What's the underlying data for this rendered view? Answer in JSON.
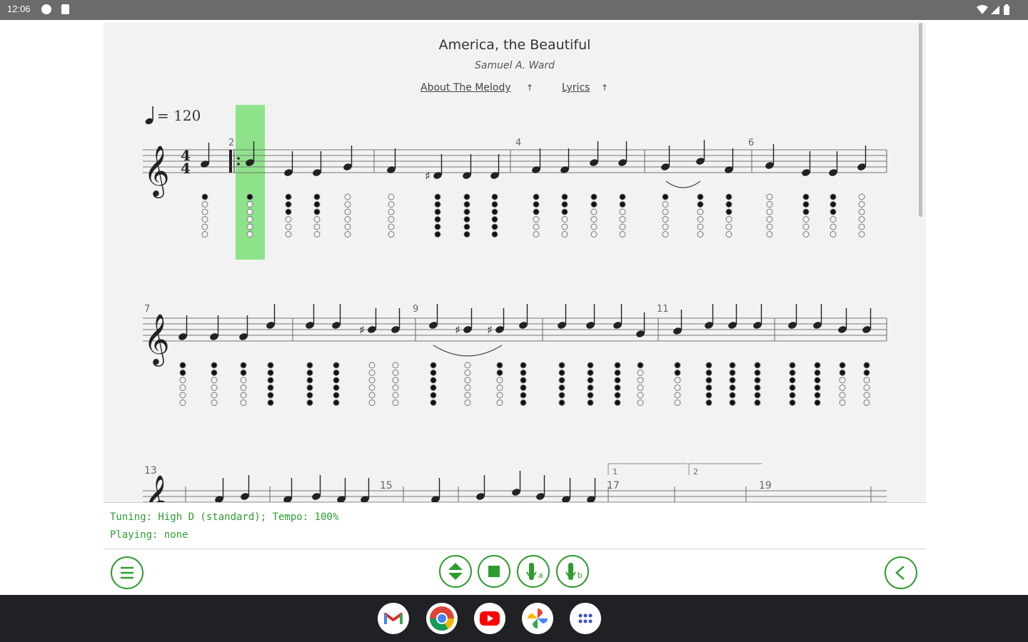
{
  "status_bar": {
    "time": "12:06"
  },
  "sheet": {
    "title": "America, the Beautiful",
    "author": "Samuel A. Ward",
    "links": [
      {
        "label": "About The Melody",
        "arrow": "↑"
      },
      {
        "label": "Lyrics",
        "arrow": "↑"
      }
    ],
    "tempo": "= 120",
    "time_signature": {
      "top": "4",
      "bottom": "4"
    },
    "measure_numbers": [
      "2",
      "4",
      "6",
      "7",
      "9",
      "11",
      "13",
      "15",
      "17",
      "19"
    ],
    "volta_labels": [
      "1",
      "2"
    ]
  },
  "info": {
    "tuning_line": "Tuning:  High D (standard); Tempo:   100%",
    "playing_line": "Playing: none"
  },
  "toolbar": {
    "buttons": [
      "menu-icon",
      "up-down-icon",
      "stop-icon",
      "whistle-a-icon",
      "whistle-b-icon",
      "back-icon"
    ],
    "whistle_a_label": "a",
    "whistle_b_label": "b"
  },
  "dock": {
    "apps": [
      "gmail-icon",
      "chrome-icon",
      "youtube-icon",
      "photos-icon",
      "app-grid-icon"
    ]
  },
  "colors": {
    "accent": "#2e9c2e",
    "highlight": "#8ee38a",
    "sheet_bg": "#f2f2f2",
    "nav_bg": "#202124",
    "status_bg": "#6b6b6b"
  }
}
